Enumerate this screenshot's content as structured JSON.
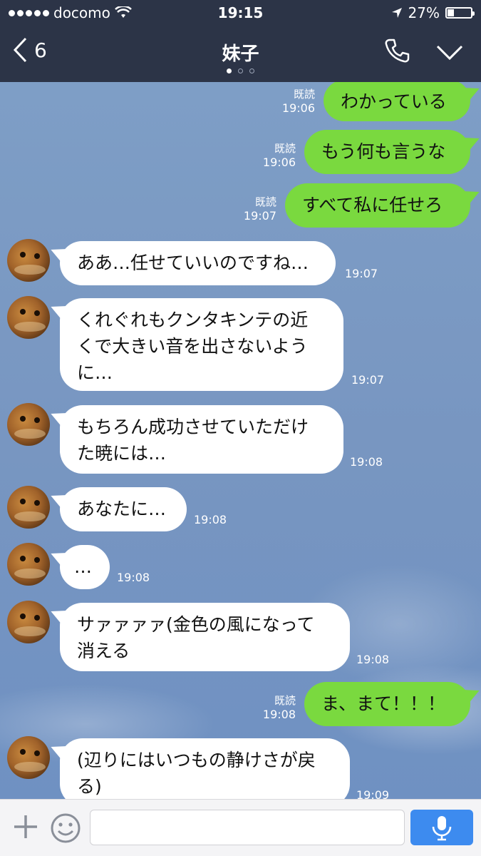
{
  "status_bar": {
    "carrier": "docomo",
    "time": "19:15",
    "battery_percent": "27%",
    "battery_level": 0.27
  },
  "header": {
    "back_count": "6",
    "title": "妹子",
    "pager": {
      "count": 3,
      "active": 0
    }
  },
  "messages": [
    {
      "side": "out",
      "text": "わかっている",
      "read": "既読",
      "time": "19:06"
    },
    {
      "side": "out",
      "text": "もう何も言うな",
      "read": "既読",
      "time": "19:06"
    },
    {
      "side": "out",
      "text": "すべて私に任せろ",
      "read": "既読",
      "time": "19:07"
    },
    {
      "side": "in",
      "text": "ああ…任せていいのですね…",
      "time": "19:07"
    },
    {
      "side": "in",
      "text": "くれぐれもクンタキンテの近\nくで大きい音を出さないよう\nに…",
      "time": "19:07"
    },
    {
      "side": "in",
      "text": "もちろん成功させていただけ\nた暁には…",
      "time": "19:08"
    },
    {
      "side": "in",
      "text": "あなたに…",
      "time": "19:08"
    },
    {
      "side": "in",
      "text": "…",
      "time": "19:08"
    },
    {
      "side": "in",
      "text": "サァァァァ(金色の風になって\n消える",
      "time": "19:08"
    },
    {
      "side": "out",
      "text": "ま、まて！！！",
      "read": "既読",
      "time": "19:08"
    },
    {
      "side": "in",
      "text": "(辺りにはいつもの静けさが戻\nる)",
      "time": "19:09"
    }
  ],
  "input": {
    "placeholder": ""
  },
  "icons": {
    "status": [
      "signal-dots-icon",
      "wifi-icon",
      "location-arrow-icon",
      "battery-icon"
    ],
    "header": [
      "back-chevron-icon",
      "phone-icon",
      "chevron-down-icon"
    ],
    "input": [
      "plus-icon",
      "smile-icon",
      "mic-icon"
    ]
  },
  "colors": {
    "header_bg": "#2c3447",
    "chat_bg": "#7f9fc6",
    "outgoing_bubble": "#7ad93f",
    "incoming_bubble": "#ffffff",
    "mic_button": "#3d8bef"
  }
}
